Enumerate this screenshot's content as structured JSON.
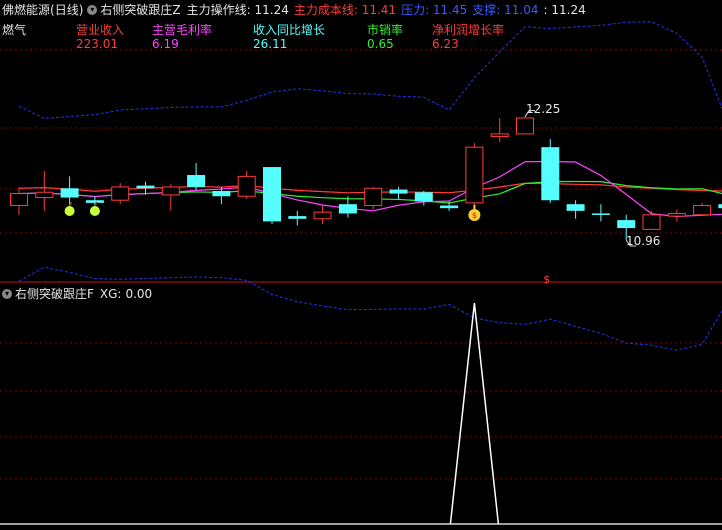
{
  "header": {
    "stock_name": "佛燃能源",
    "period": "(日线)",
    "indicator": "右侧突破跟庄Z",
    "items": [
      {
        "label": "主力操作线:",
        "value": "11.24",
        "color": "#e6e6e6"
      },
      {
        "label": "主力成本线:",
        "value": "11.41",
        "color": "#ff3b3b"
      },
      {
        "label": "压力:",
        "value": "11.45",
        "color": "#3b5bff"
      },
      {
        "label": "支撑:",
        "value": "11.04",
        "color": "#3b5bff"
      },
      {
        "label": ":",
        "value": "11.24",
        "color": "#e6e6e6"
      }
    ]
  },
  "info": {
    "sector": "燃气",
    "metrics": [
      {
        "label": "营业收入",
        "value": "223.01",
        "color": "#ff3b3b"
      },
      {
        "label": "主营毛利率",
        "value": "6.19",
        "color": "#ff44ff"
      },
      {
        "label": "收入同比增长",
        "value": "26.11",
        "color": "#55ffff"
      },
      {
        "label": "市销率",
        "value": "0.65",
        "color": "#33ee33"
      },
      {
        "label": "净利润增长率",
        "value": "6.23",
        "color": "#ff3b3b"
      }
    ]
  },
  "lower_panel": {
    "indicator": "右侧突破跟庄F",
    "xg_label": "XG:",
    "xg_value": "0.00"
  },
  "chart_data": {
    "type": "candlestick",
    "price_axis_hint": [
      10.6,
      12.5
    ],
    "high_label": "12.25",
    "low_label": "10.96",
    "candles": [
      {
        "o": 11.22,
        "c": 11.31,
        "h": 11.36,
        "l": 11.15
      },
      {
        "o": 11.28,
        "c": 11.32,
        "h": 11.48,
        "l": 11.18
      },
      {
        "o": 11.35,
        "c": 11.28,
        "h": 11.44,
        "l": 11.22
      },
      {
        "o": 11.26,
        "c": 11.24,
        "h": 11.29,
        "l": 11.18
      },
      {
        "o": 11.26,
        "c": 11.36,
        "h": 11.39,
        "l": 11.23
      },
      {
        "o": 11.37,
        "c": 11.35,
        "h": 11.4,
        "l": 11.3
      },
      {
        "o": 11.3,
        "c": 11.36,
        "h": 11.38,
        "l": 11.18
      },
      {
        "o": 11.45,
        "c": 11.36,
        "h": 11.54,
        "l": 11.34
      },
      {
        "o": 11.33,
        "c": 11.29,
        "h": 11.36,
        "l": 11.23
      },
      {
        "o": 11.29,
        "c": 11.44,
        "h": 11.48,
        "l": 11.27
      },
      {
        "o": 11.51,
        "c": 11.1,
        "h": 11.51,
        "l": 11.08
      },
      {
        "o": 11.14,
        "c": 11.12,
        "h": 11.18,
        "l": 11.07
      },
      {
        "o": 11.12,
        "c": 11.17,
        "h": 11.22,
        "l": 11.08
      },
      {
        "o": 11.23,
        "c": 11.16,
        "h": 11.29,
        "l": 11.13
      },
      {
        "o": 11.22,
        "c": 11.35,
        "h": 11.36,
        "l": 11.19
      },
      {
        "o": 11.34,
        "c": 11.31,
        "h": 11.36,
        "l": 11.27
      },
      {
        "o": 11.32,
        "c": 11.25,
        "h": 11.33,
        "l": 11.22
      },
      {
        "o": 11.22,
        "c": 11.2,
        "h": 11.25,
        "l": 11.18
      },
      {
        "o": 11.24,
        "c": 11.66,
        "h": 11.69,
        "l": 11.2
      },
      {
        "o": 11.74,
        "c": 11.76,
        "h": 11.88,
        "l": 11.7
      },
      {
        "o": 11.76,
        "c": 11.88,
        "h": 11.89,
        "l": 11.76
      },
      {
        "o": 11.66,
        "c": 11.26,
        "h": 11.72,
        "l": 11.24
      },
      {
        "o": 11.23,
        "c": 11.18,
        "h": 11.26,
        "l": 11.12
      },
      {
        "o": 11.16,
        "c": 11.15,
        "h": 11.23,
        "l": 11.1
      },
      {
        "o": 11.11,
        "c": 11.05,
        "h": 11.15,
        "l": 10.96
      },
      {
        "o": 11.04,
        "c": 11.15,
        "h": 11.18,
        "l": 11.04
      },
      {
        "o": 11.14,
        "c": 11.16,
        "h": 11.19,
        "l": 11.1
      },
      {
        "o": 11.15,
        "c": 11.22,
        "h": 11.24,
        "l": 11.15
      },
      {
        "o": 11.23,
        "c": 11.2,
        "h": 11.29,
        "l": 11.17
      }
    ],
    "markers": [
      {
        "type": "apple",
        "index": 2
      },
      {
        "type": "apple",
        "index": 3
      },
      {
        "type": "money",
        "index": 18
      },
      {
        "type": "signal",
        "index": 21
      }
    ],
    "xg_series": [
      0,
      0,
      0,
      0,
      0,
      0,
      0,
      0,
      0,
      0,
      0,
      0,
      0,
      0,
      0,
      0,
      0,
      0,
      1,
      0,
      0,
      0,
      0,
      0,
      0,
      0,
      0,
      0,
      0
    ],
    "colors": {
      "up": "#ff3b3b",
      "down": "#55ffff",
      "ma_short": "#ff44ff",
      "ma_long": "#33ee33",
      "cost": "#ff3b3b",
      "band": "#2233ee",
      "panel_line": "#ffffff",
      "grid": "#8b0000"
    }
  }
}
